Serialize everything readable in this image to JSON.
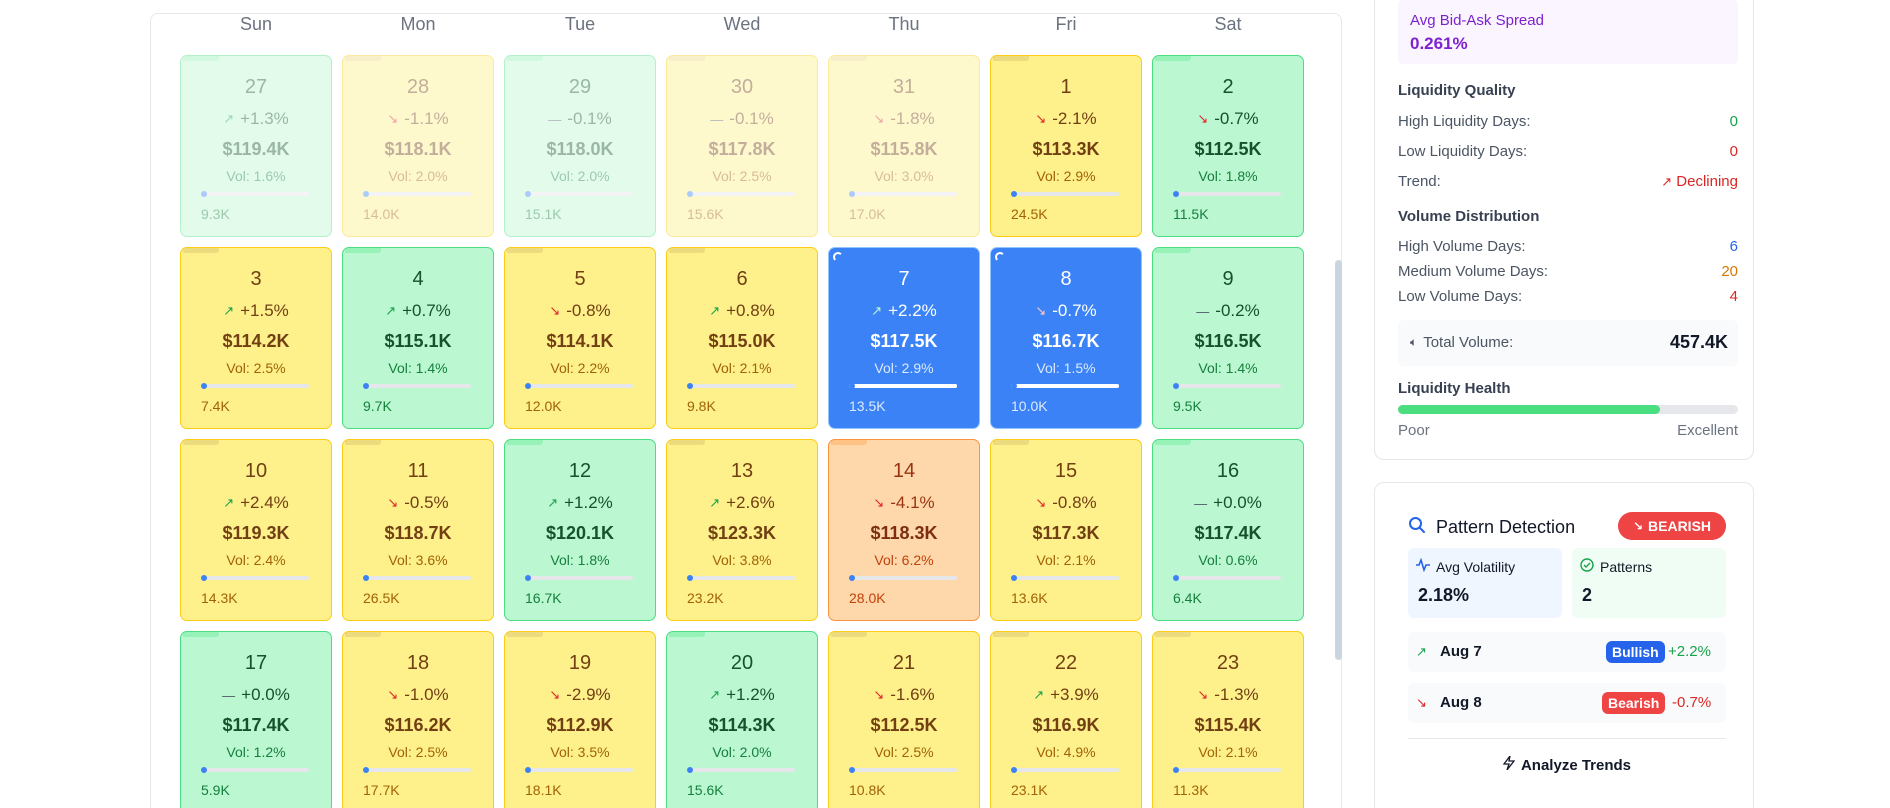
{
  "calendar": {
    "weekdays": [
      "Sun",
      "Mon",
      "Tue",
      "Wed",
      "Thu",
      "Fri",
      "Sat"
    ],
    "cells": [
      {
        "day": "27",
        "change": "+1.3%",
        "trend": "up",
        "price": "$119.4K",
        "vol": "Vol: 1.6%",
        "volume": "9.3K",
        "volume_level": 0.35,
        "tone": "green",
        "faded": true
      },
      {
        "day": "28",
        "change": "-1.1%",
        "trend": "down",
        "price": "$118.1K",
        "vol": "Vol: 2.0%",
        "volume": "14.0K",
        "volume_level": 0.5,
        "tone": "yellow",
        "faded": true
      },
      {
        "day": "29",
        "change": "-0.1%",
        "trend": "flat",
        "price": "$118.0K",
        "vol": "Vol: 2.0%",
        "volume": "15.1K",
        "volume_level": 0.55,
        "tone": "green",
        "faded": true
      },
      {
        "day": "30",
        "change": "-0.1%",
        "trend": "flat",
        "price": "$117.8K",
        "vol": "Vol: 2.5%",
        "volume": "15.6K",
        "volume_level": 0.56,
        "tone": "yellow",
        "faded": true
      },
      {
        "day": "31",
        "change": "-1.8%",
        "trend": "down",
        "price": "$115.8K",
        "vol": "Vol: 3.0%",
        "volume": "17.0K",
        "volume_level": 0.6,
        "tone": "yellow",
        "faded": true
      },
      {
        "day": "1",
        "change": "-2.1%",
        "trend": "down",
        "price": "$113.3K",
        "vol": "Vol: 2.9%",
        "volume": "24.5K",
        "volume_level": 0.8,
        "tone": "yellow",
        "faded": false
      },
      {
        "day": "2",
        "change": "-0.7%",
        "trend": "down",
        "price": "$112.5K",
        "vol": "Vol: 1.8%",
        "volume": "11.5K",
        "volume_level": 0.42,
        "tone": "green",
        "faded": false
      },
      {
        "day": "3",
        "change": "+1.5%",
        "trend": "up",
        "price": "$114.2K",
        "vol": "Vol: 2.5%",
        "volume": "7.4K",
        "volume_level": 0.28,
        "tone": "yellow",
        "faded": false
      },
      {
        "day": "4",
        "change": "+0.7%",
        "trend": "up",
        "price": "$115.1K",
        "vol": "Vol: 1.4%",
        "volume": "9.7K",
        "volume_level": 0.36,
        "tone": "green",
        "faded": false
      },
      {
        "day": "5",
        "change": "-0.8%",
        "trend": "down",
        "price": "$114.1K",
        "vol": "Vol: 2.2%",
        "volume": "12.0K",
        "volume_level": 0.44,
        "tone": "yellow",
        "faded": false
      },
      {
        "day": "6",
        "change": "+0.8%",
        "trend": "up",
        "price": "$115.0K",
        "vol": "Vol: 2.1%",
        "volume": "9.8K",
        "volume_level": 0.36,
        "tone": "yellow",
        "faded": false
      },
      {
        "day": "7",
        "change": "+2.2%",
        "trend": "up",
        "price": "$117.5K",
        "vol": "Vol: 2.9%",
        "volume": "13.5K",
        "volume_level": 1.0,
        "tone": "blue",
        "faded": false,
        "pattern": true
      },
      {
        "day": "8",
        "change": "-0.7%",
        "trend": "down",
        "price": "$116.7K",
        "vol": "Vol: 1.5%",
        "volume": "10.0K",
        "volume_level": 1.0,
        "tone": "blue",
        "faded": false,
        "pattern": true
      },
      {
        "day": "9",
        "change": "-0.2%",
        "trend": "flat",
        "price": "$116.5K",
        "vol": "Vol: 1.4%",
        "volume": "9.5K",
        "volume_level": 0.35,
        "tone": "green",
        "faded": false
      },
      {
        "day": "10",
        "change": "+2.4%",
        "trend": "up",
        "price": "$119.3K",
        "vol": "Vol: 2.4%",
        "volume": "14.3K",
        "volume_level": 0.5,
        "tone": "yellow",
        "faded": false
      },
      {
        "day": "11",
        "change": "-0.5%",
        "trend": "down",
        "price": "$118.7K",
        "vol": "Vol: 3.6%",
        "volume": "26.5K",
        "volume_level": 0.85,
        "tone": "yellow",
        "faded": false
      },
      {
        "day": "12",
        "change": "+1.2%",
        "trend": "up",
        "price": "$120.1K",
        "vol": "Vol: 1.8%",
        "volume": "16.7K",
        "volume_level": 0.58,
        "tone": "green",
        "faded": false
      },
      {
        "day": "13",
        "change": "+2.6%",
        "trend": "up",
        "price": "$123.3K",
        "vol": "Vol: 3.8%",
        "volume": "23.2K",
        "volume_level": 0.78,
        "tone": "yellow",
        "faded": false
      },
      {
        "day": "14",
        "change": "-4.1%",
        "trend": "down",
        "price": "$118.3K",
        "vol": "Vol: 6.2%",
        "volume": "28.0K",
        "volume_level": 0.9,
        "tone": "orange",
        "faded": false
      },
      {
        "day": "15",
        "change": "-0.8%",
        "trend": "down",
        "price": "$117.3K",
        "vol": "Vol: 2.1%",
        "volume": "13.6K",
        "volume_level": 0.48,
        "tone": "yellow",
        "faded": false
      },
      {
        "day": "16",
        "change": "+0.0%",
        "trend": "flat",
        "price": "$117.4K",
        "vol": "Vol: 0.6%",
        "volume": "6.4K",
        "volume_level": 0.24,
        "tone": "green",
        "faded": false
      },
      {
        "day": "17",
        "change": "+0.0%",
        "trend": "flat",
        "price": "$117.4K",
        "vol": "Vol: 1.2%",
        "volume": "5.9K",
        "volume_level": 0.22,
        "tone": "green",
        "faded": false
      },
      {
        "day": "18",
        "change": "-1.0%",
        "trend": "down",
        "price": "$116.2K",
        "vol": "Vol: 2.5%",
        "volume": "17.7K",
        "volume_level": 0.6,
        "tone": "yellow",
        "faded": false
      },
      {
        "day": "19",
        "change": "-2.9%",
        "trend": "down",
        "price": "$112.9K",
        "vol": "Vol: 3.5%",
        "volume": "18.1K",
        "volume_level": 0.62,
        "tone": "yellow",
        "faded": false
      },
      {
        "day": "20",
        "change": "+1.2%",
        "trend": "up",
        "price": "$114.3K",
        "vol": "Vol: 2.0%",
        "volume": "15.6K",
        "volume_level": 0.55,
        "tone": "green",
        "faded": false
      },
      {
        "day": "21",
        "change": "-1.6%",
        "trend": "down",
        "price": "$112.5K",
        "vol": "Vol: 2.5%",
        "volume": "10.8K",
        "volume_level": 0.4,
        "tone": "yellow",
        "faded": false
      },
      {
        "day": "22",
        "change": "+3.9%",
        "trend": "up",
        "price": "$116.9K",
        "vol": "Vol: 4.9%",
        "volume": "23.1K",
        "volume_level": 0.78,
        "tone": "yellow",
        "faded": false
      },
      {
        "day": "23",
        "change": "-1.3%",
        "trend": "down",
        "price": "$115.4K",
        "vol": "Vol: 2.1%",
        "volume": "11.3K",
        "volume_level": 0.42,
        "tone": "yellow",
        "faded": false
      }
    ]
  },
  "liquidity": {
    "spread_label": "Avg Bid-Ask Spread",
    "spread_value": "0.261%",
    "quality_title": "Liquidity Quality",
    "high_days_label": "High Liquidity Days:",
    "high_days_value": "0",
    "low_days_label": "Low Liquidity Days:",
    "low_days_value": "0",
    "trend_label": "Trend:",
    "trend_value": "Declining",
    "dist_title": "Volume Distribution",
    "high_vol_label": "High Volume Days:",
    "high_vol_value": "6",
    "med_vol_label": "Medium Volume Days:",
    "med_vol_value": "20",
    "low_vol_label": "Low Volume Days:",
    "low_vol_value": "4",
    "total_label": "Total Volume:",
    "total_value": "457.4K",
    "health_title": "Liquidity Health",
    "health_level": 0.77,
    "health_poor": "Poor",
    "health_excellent": "Excellent"
  },
  "pattern": {
    "title": "Pattern Detection",
    "badge": "BEARISH",
    "avg_vol_label": "Avg Volatility",
    "avg_vol_value": "2.18%",
    "patterns_label": "Patterns",
    "patterns_value": "2",
    "rows": [
      {
        "date": "Aug 7",
        "tag": "Bullish",
        "change": "+2.2%"
      },
      {
        "date": "Aug 8",
        "tag": "Bearish",
        "change": "-0.7%"
      }
    ],
    "analyze_label": "Analyze Trends"
  },
  "colors": {
    "green_cell": "#bbf7d0",
    "yellow_cell": "#fef08a",
    "orange_cell": "#fed7aa",
    "blue_cell": "#3b82f6",
    "bearish": "#ef4444",
    "bullish": "#2563eb"
  }
}
